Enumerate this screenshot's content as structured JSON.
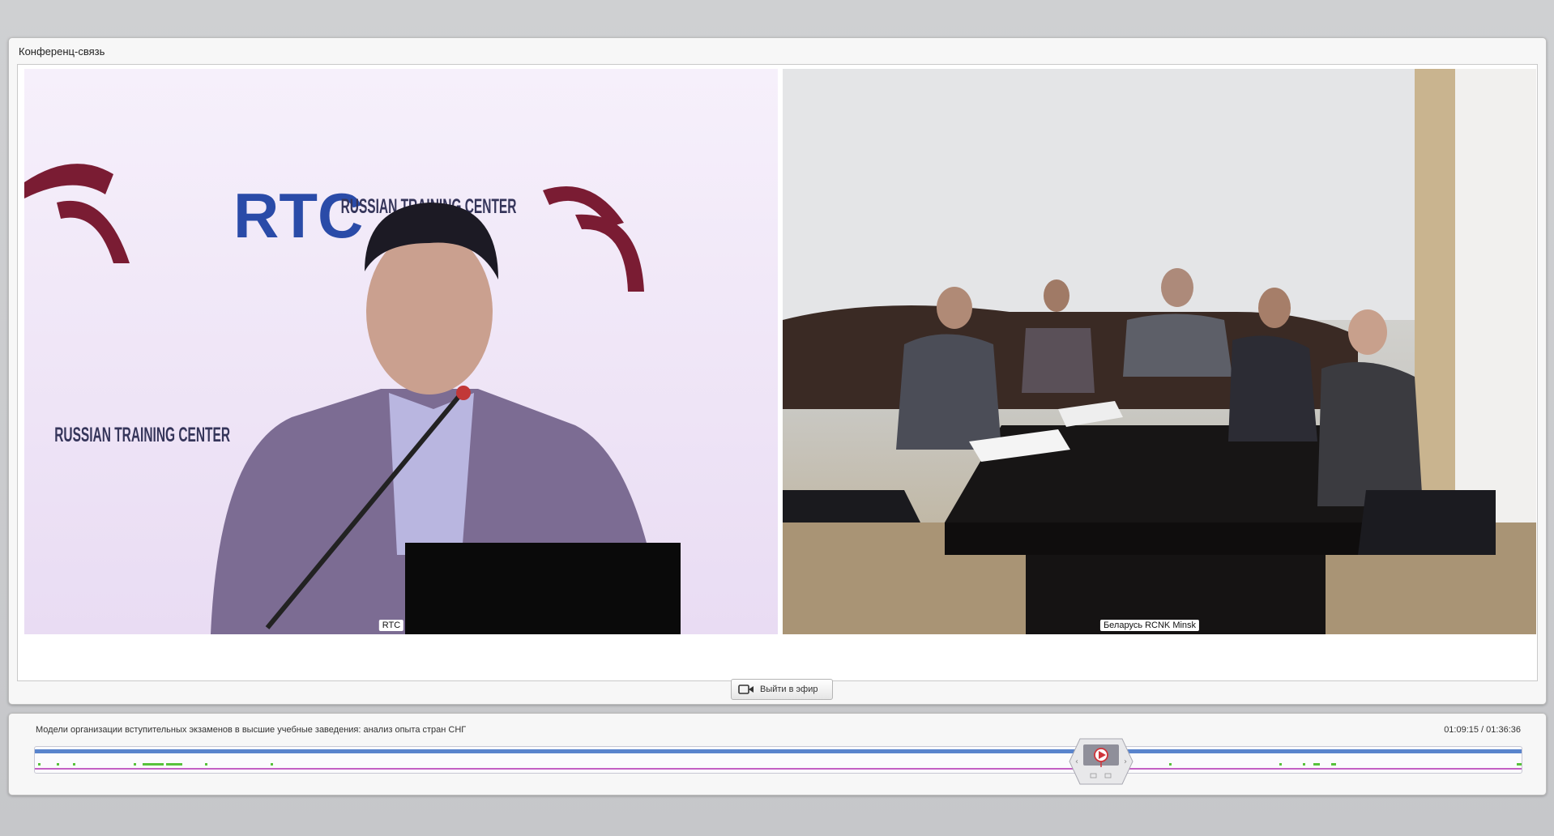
{
  "panel": {
    "title": "Конференц-связь"
  },
  "videos": [
    {
      "label": "RTC",
      "backdrop_text": "RUSSIAN TRAINING CENTER",
      "logo_text": "RTC"
    },
    {
      "label": "Беларусь RCNK Minsk"
    }
  ],
  "controls": {
    "go_live_label": "Выйти в эфир",
    "go_live_icon": "camera-icon"
  },
  "timeline": {
    "title": "Модели организации вступительных экзаменов в высшие учебные заведения: анализ опыта стран СНГ",
    "time_display": "01:09:15 / 01:36:36",
    "current_seconds": 4155,
    "total_seconds": 5796,
    "progress_fraction": 0.717
  },
  "colors": {
    "track_blue": "#3c6fc4",
    "track_magenta": "#c45fc4",
    "activity_green": "#58c23c",
    "playhead_red": "#d0343a"
  }
}
